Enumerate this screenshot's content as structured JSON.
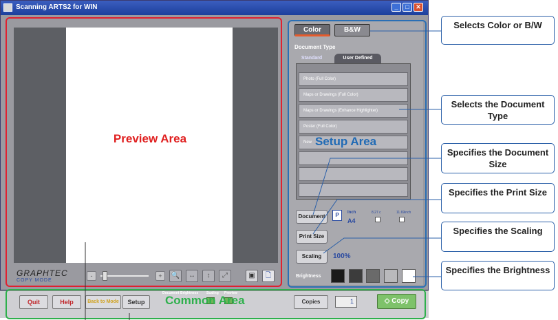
{
  "window": {
    "title": "Scanning ARTS2 for WIN",
    "controls": {
      "minimize": "_",
      "maximize": "□",
      "close": "✕"
    }
  },
  "preview": {
    "area_label": "Preview Area",
    "logo": {
      "main": "GRAPHTEC",
      "sub": "COPY MODE"
    },
    "zoom": {
      "minus": "-",
      "plus": "+",
      "level": 0.08
    },
    "tools": [
      "🔍",
      "↔",
      "↕",
      "⤢",
      "▦"
    ],
    "save_glyph": "▣",
    "doc_glyph": "🗋"
  },
  "setup": {
    "area_label": "Setup Area",
    "color_tabs": {
      "color": "Color",
      "bw": "B&W"
    },
    "document_type_title": "Document Type",
    "doc_tabs": {
      "standard": "Standard",
      "user_defined": "User Defined"
    },
    "doc_types": [
      "Photo (Full Color)",
      "Maps or Drawings (Full Color)",
      "Maps or Drawings (Enhance Highlighter)",
      "Poster (Full Color)",
      "New"
    ],
    "document_btn": "Document",
    "document_size": {
      "icon": "P",
      "unit": "Inch",
      "paper": "A4"
    },
    "print_size_btn": "Print Size",
    "width_val": "8.27 c",
    "height_val": "11.69inch",
    "scaling_btn": "Scaling",
    "scaling_value": "100%",
    "brightness_label": "Brightness",
    "brightness_swatches": [
      "#1a1a1a",
      "#3c3c3c",
      "#6a6a6a",
      "#b9b9bc",
      "#ffffff"
    ]
  },
  "common": {
    "area_label": "Common Area",
    "quit": "Quit",
    "help": "Help",
    "back": "Back to Mode",
    "setup": "Setup",
    "tiny_labels": [
      "Document",
      "Brightness",
      "Scaling",
      "Preview"
    ],
    "copies_btn": "Copies",
    "copies_value": "1",
    "copy_btn": "Copy"
  },
  "callouts": [
    "Selects Color or B/W",
    "Selects the Document Type",
    "Specifies the Document Size",
    "Specifies the Print Size",
    "Specifies the Scaling",
    "Specifies the Brightness"
  ],
  "colors": {
    "preview_frame": "#e02030",
    "setup_frame": "#2a6fb5",
    "common_frame": "#2eb04c",
    "callout_line": "#2a5fa8"
  }
}
